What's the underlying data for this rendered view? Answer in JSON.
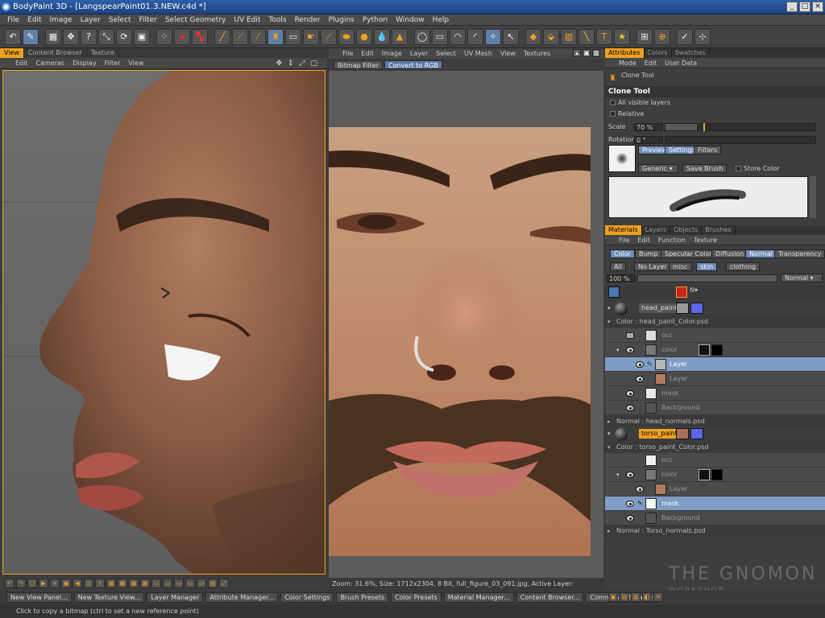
{
  "window": {
    "title": "BodyPaint 3D - [LangspearPaint01.3.NEW.c4d *]",
    "controls": [
      "_",
      "□",
      "×"
    ]
  },
  "menubar": [
    "File",
    "Edit",
    "Image",
    "Layer",
    "Select",
    "Filter",
    "Select Geometry",
    "UV Edit",
    "Tools",
    "Render",
    "Plugins",
    "Python",
    "Window",
    "Help"
  ],
  "colors": {
    "accent": "#f0a020",
    "selection": "#7e9cc4",
    "blue_swatch": "#5b67e8",
    "bg": "#3c3c3c"
  },
  "viewport": {
    "tabs": [
      {
        "label": "View",
        "active": true
      },
      {
        "label": "Content Browser",
        "active": false
      },
      {
        "label": "Texture",
        "active": false
      }
    ],
    "menu": [
      "Edit",
      "Cameras",
      "Display",
      "Filter",
      "View"
    ],
    "nav_icons": "✥ ↕ ⤢ ▢"
  },
  "texture_view": {
    "menu": [
      "File",
      "Edit",
      "Image",
      "Layer",
      "Select",
      "UV Mesh",
      "View",
      "Textures"
    ],
    "filter_chips": [
      "Bitmap Filter",
      "Convert to RGB"
    ],
    "status": "Zoom: 31.6%, Size: 1712x2304, 8 Bit, full_figure_03_091.jpg, Active Layer: Background"
  },
  "attributes": {
    "tabs": [
      {
        "label": "Attributes",
        "active": true
      },
      {
        "label": "Colors",
        "active": false
      },
      {
        "label": "Swatches",
        "active": false
      }
    ],
    "menu": [
      "Mode",
      "Edit",
      "User Data"
    ],
    "tool_label": "Clone Tool",
    "section_title": "Clone Tool",
    "all_visible_layers": "All visible layers",
    "relative": "Relative",
    "scale_label": "Scale",
    "scale_value": "70 %",
    "scale_fraction": 0.7,
    "rotation_label": "Rotation",
    "rotation_value": "0 °",
    "brush_tabs": [
      {
        "label": "Preview",
        "active": true
      },
      {
        "label": "Settings",
        "active": true
      },
      {
        "label": "Filters",
        "active": false
      }
    ],
    "preset": "Generic",
    "save_brush": "Save Brush",
    "store_color": "Store Color"
  },
  "materials": {
    "tabs": [
      {
        "label": "Materials",
        "active": true
      },
      {
        "label": "Layers",
        "active": false
      },
      {
        "label": "Objects",
        "active": false
      },
      {
        "label": "Brushes",
        "active": false
      }
    ],
    "menu": [
      "File",
      "Edit",
      "Function",
      "Texture"
    ],
    "channels": [
      {
        "label": "Color",
        "active": true
      },
      {
        "label": "Bump",
        "active": false
      },
      {
        "label": "Specular Color",
        "active": false
      },
      {
        "label": "Diffusion",
        "active": false
      },
      {
        "label": "Normal",
        "active": true
      },
      {
        "label": "Transparency",
        "active": false
      }
    ],
    "layer_sets": [
      {
        "label": "All",
        "active": false
      },
      {
        "label": "No Layer",
        "active": false
      },
      {
        "label": "misc",
        "active": false
      },
      {
        "label": "skin",
        "active": true
      },
      {
        "label": "clothing",
        "active": false
      }
    ],
    "opacity": "100 %",
    "blend_mode": "Normal",
    "head_material": "head_paint",
    "head_color_file": "Color : head_paint_Color.psd",
    "head_layers": [
      "occ",
      "color",
      "Layer",
      "Layer",
      "mask",
      "Background"
    ],
    "head_normal_file": "Normal : head_normals.psd",
    "torso_material": "torso_paint",
    "torso_color_file": "Color : torso_paint_Color.psd",
    "torso_layers": [
      "occ",
      "color",
      "Layer",
      "mask",
      "Background"
    ],
    "torso_normal_file": "Normal : Torso_normals.psd"
  },
  "bottom_buttons": [
    "New View Panel...",
    "New Texture View...",
    "Layer Manager",
    "Attribute Manager...",
    "Color Settings",
    "Brush Presets",
    "Color Presets",
    "Material Manager...",
    "Content Browser...",
    "Command Manager"
  ],
  "status_bar": "Click to copy a bitmap (ctrl to set a new reference point)",
  "watermark": {
    "line1": "THE GNOMON",
    "line2": "WORKSHOP"
  }
}
